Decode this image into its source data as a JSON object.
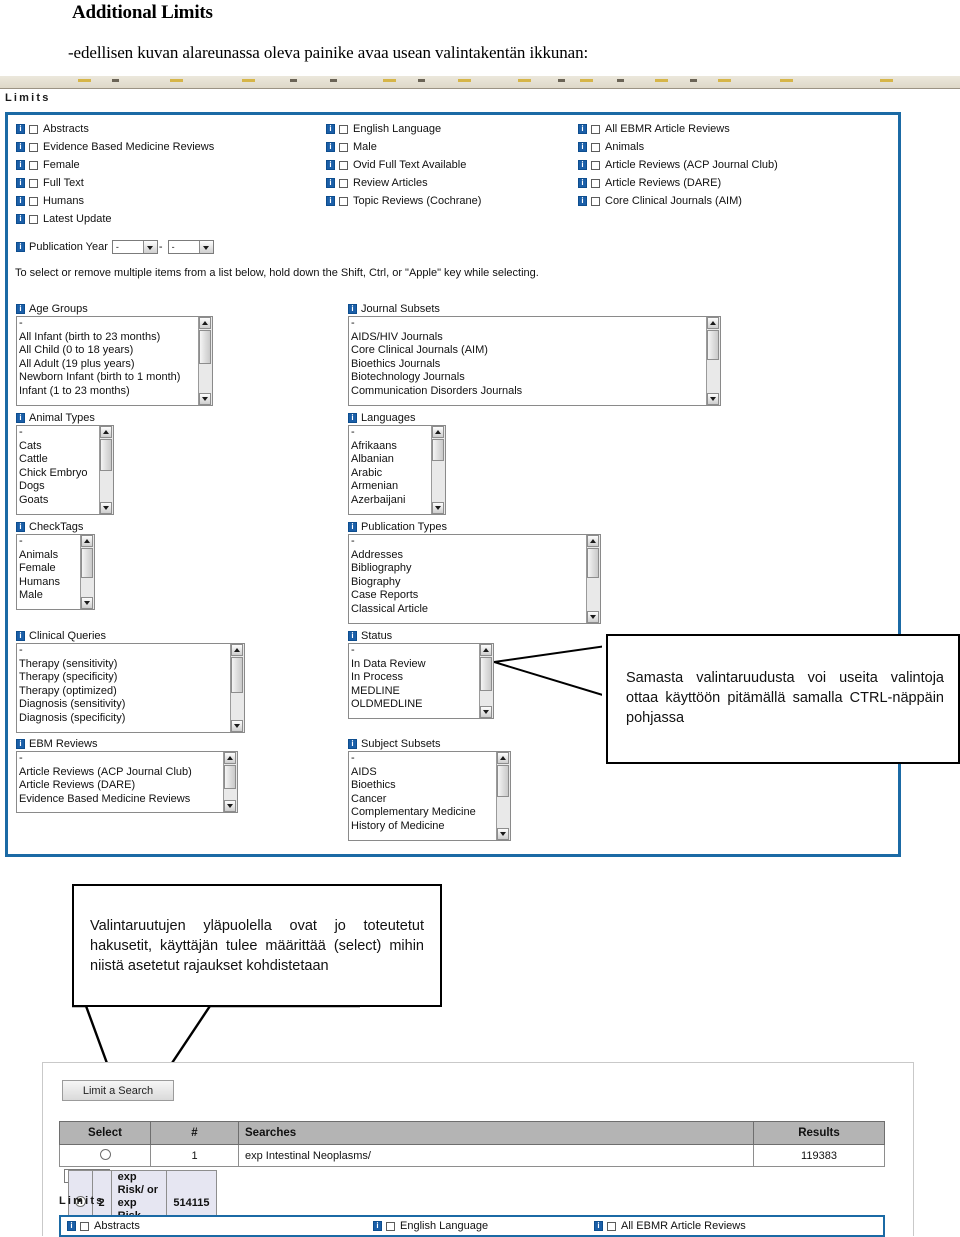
{
  "document": {
    "title": "Additional Limits",
    "subtitle": "-edellisen kuvan alareunassa oleva painike avaa usean valintakentän ikkunan:"
  },
  "panel": {
    "section_label": "Limits",
    "border_color": "#1b6aa5",
    "instruction": "To select or remove multiple items from a list below, hold down the Shift, Ctrl, or \"Apple\" key while selecting.",
    "checkbox_columns": [
      {
        "items": [
          {
            "label": "Abstracts",
            "checked": false
          },
          {
            "label": "Evidence Based Medicine Reviews",
            "checked": false
          },
          {
            "label": "Female",
            "checked": false
          },
          {
            "label": "Full Text",
            "checked": false
          },
          {
            "label": "Humans",
            "checked": false
          },
          {
            "label": "Latest Update",
            "checked": false
          }
        ]
      },
      {
        "items": [
          {
            "label": "English Language",
            "checked": false
          },
          {
            "label": "Male",
            "checked": false
          },
          {
            "label": "Ovid Full Text Available",
            "checked": false
          },
          {
            "label": "Review Articles",
            "checked": false
          },
          {
            "label": "Topic Reviews (Cochrane)",
            "checked": false
          }
        ]
      },
      {
        "items": [
          {
            "label": "All EBMR Article Reviews",
            "checked": false
          },
          {
            "label": "Animals",
            "checked": false
          },
          {
            "label": "Article Reviews (ACP Journal Club)",
            "checked": false
          },
          {
            "label": "Article Reviews (DARE)",
            "checked": false
          },
          {
            "label": "Core Clinical Journals (AIM)",
            "checked": false
          }
        ]
      }
    ],
    "publication_year": {
      "label": "Publication Year",
      "from_value": "-",
      "to_value": "-",
      "separator": "-"
    },
    "lists": [
      {
        "label": "Age Groups",
        "options": [
          "-",
          "All Infant (birth to 23 months)",
          "All Child (0 to 18 years)",
          "All Adult (19 plus years)",
          "Newborn Infant (birth to 1 month)",
          "Infant (1 to 23 months)"
        ]
      },
      {
        "label": "Journal Subsets",
        "options": [
          "-",
          "AIDS/HIV Journals",
          "Core Clinical Journals (AIM)",
          "Bioethics Journals",
          "Biotechnology Journals",
          "Communication Disorders Journals"
        ]
      },
      {
        "label": "Animal Types",
        "options": [
          "-",
          "Cats",
          "Cattle",
          "Chick Embryo",
          "Dogs",
          "Goats"
        ]
      },
      {
        "label": "Languages",
        "options": [
          "-",
          "Afrikaans",
          "Albanian",
          "Arabic",
          "Armenian",
          "Azerbaijani"
        ]
      },
      {
        "label": "CheckTags",
        "options": [
          "-",
          "Animals",
          "Female",
          "Humans",
          "Male"
        ]
      },
      {
        "label": "Publication Types",
        "options": [
          "-",
          "Addresses",
          "Bibliography",
          "Biography",
          "Case Reports",
          "Classical Article"
        ]
      },
      {
        "label": "Clinical Queries",
        "options": [
          "-",
          "Therapy (sensitivity)",
          "Therapy (specificity)",
          "Therapy (optimized)",
          "Diagnosis (sensitivity)",
          "Diagnosis (specificity)"
        ]
      },
      {
        "label": "Status",
        "options": [
          "-",
          "In Data Review",
          "In Process",
          "MEDLINE",
          "OLDMEDLINE"
        ]
      },
      {
        "label": "EBM Reviews",
        "options": [
          "-",
          "Article Reviews (ACP Journal Club)",
          "Article Reviews (DARE)",
          "Evidence Based Medicine Reviews"
        ]
      },
      {
        "label": "Subject Subsets",
        "options": [
          "-",
          "AIDS",
          "Bioethics",
          "Cancer",
          "Complementary Medicine",
          "History of Medicine"
        ]
      }
    ]
  },
  "callouts": [
    {
      "text": "Samasta valintaruudusta voi useita valintoja ottaa käyttöön pitämällä samalla CTRL-näppäin pohjassa"
    },
    {
      "text": "Valintaruutujen yläpuolella ovat jo toteutetut hakusetit, käyttäjän tulee määrittää (select) mihin niistä asetetut rajaukset kohdistetaan"
    }
  ],
  "results": {
    "limit_button_label": "Limit a Search",
    "columns": [
      "Select",
      "#",
      "Searches",
      "Results"
    ],
    "rows": [
      {
        "selected": false,
        "num": "1",
        "query": "exp Intestinal Neoplasms/",
        "results": "119383"
      },
      {
        "selected": true,
        "num": "2",
        "query": "exp Risk/ or exp Risk Factors/",
        "results": "514115"
      }
    ],
    "limits_label": "Limits",
    "limits_checkboxes": [
      {
        "label": "Abstracts",
        "checked": false
      },
      {
        "label": "English Language",
        "checked": false
      },
      {
        "label": "All EBMR Article Reviews",
        "checked": false
      }
    ]
  }
}
